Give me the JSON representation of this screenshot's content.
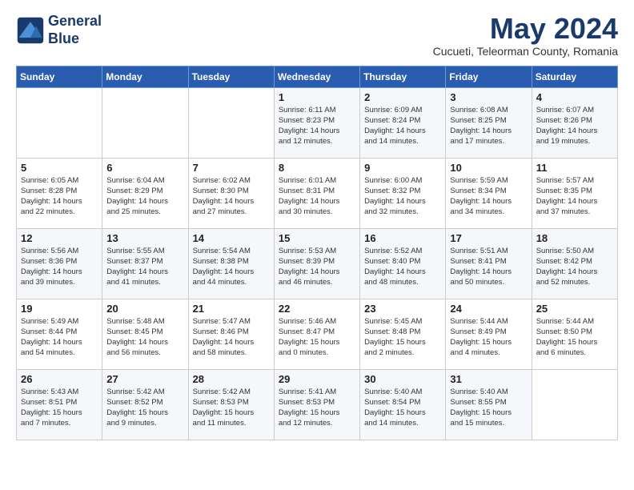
{
  "header": {
    "logo_line1": "General",
    "logo_line2": "Blue",
    "month_title": "May 2024",
    "location": "Cucueti, Teleorman County, Romania"
  },
  "weekdays": [
    "Sunday",
    "Monday",
    "Tuesday",
    "Wednesday",
    "Thursday",
    "Friday",
    "Saturday"
  ],
  "weeks": [
    [
      {
        "date": "",
        "content": ""
      },
      {
        "date": "",
        "content": ""
      },
      {
        "date": "",
        "content": ""
      },
      {
        "date": "1",
        "content": "Sunrise: 6:11 AM\nSunset: 8:23 PM\nDaylight: 14 hours\nand 12 minutes."
      },
      {
        "date": "2",
        "content": "Sunrise: 6:09 AM\nSunset: 8:24 PM\nDaylight: 14 hours\nand 14 minutes."
      },
      {
        "date": "3",
        "content": "Sunrise: 6:08 AM\nSunset: 8:25 PM\nDaylight: 14 hours\nand 17 minutes."
      },
      {
        "date": "4",
        "content": "Sunrise: 6:07 AM\nSunset: 8:26 PM\nDaylight: 14 hours\nand 19 minutes."
      }
    ],
    [
      {
        "date": "5",
        "content": "Sunrise: 6:05 AM\nSunset: 8:28 PM\nDaylight: 14 hours\nand 22 minutes."
      },
      {
        "date": "6",
        "content": "Sunrise: 6:04 AM\nSunset: 8:29 PM\nDaylight: 14 hours\nand 25 minutes."
      },
      {
        "date": "7",
        "content": "Sunrise: 6:02 AM\nSunset: 8:30 PM\nDaylight: 14 hours\nand 27 minutes."
      },
      {
        "date": "8",
        "content": "Sunrise: 6:01 AM\nSunset: 8:31 PM\nDaylight: 14 hours\nand 30 minutes."
      },
      {
        "date": "9",
        "content": "Sunrise: 6:00 AM\nSunset: 8:32 PM\nDaylight: 14 hours\nand 32 minutes."
      },
      {
        "date": "10",
        "content": "Sunrise: 5:59 AM\nSunset: 8:34 PM\nDaylight: 14 hours\nand 34 minutes."
      },
      {
        "date": "11",
        "content": "Sunrise: 5:57 AM\nSunset: 8:35 PM\nDaylight: 14 hours\nand 37 minutes."
      }
    ],
    [
      {
        "date": "12",
        "content": "Sunrise: 5:56 AM\nSunset: 8:36 PM\nDaylight: 14 hours\nand 39 minutes."
      },
      {
        "date": "13",
        "content": "Sunrise: 5:55 AM\nSunset: 8:37 PM\nDaylight: 14 hours\nand 41 minutes."
      },
      {
        "date": "14",
        "content": "Sunrise: 5:54 AM\nSunset: 8:38 PM\nDaylight: 14 hours\nand 44 minutes."
      },
      {
        "date": "15",
        "content": "Sunrise: 5:53 AM\nSunset: 8:39 PM\nDaylight: 14 hours\nand 46 minutes."
      },
      {
        "date": "16",
        "content": "Sunrise: 5:52 AM\nSunset: 8:40 PM\nDaylight: 14 hours\nand 48 minutes."
      },
      {
        "date": "17",
        "content": "Sunrise: 5:51 AM\nSunset: 8:41 PM\nDaylight: 14 hours\nand 50 minutes."
      },
      {
        "date": "18",
        "content": "Sunrise: 5:50 AM\nSunset: 8:42 PM\nDaylight: 14 hours\nand 52 minutes."
      }
    ],
    [
      {
        "date": "19",
        "content": "Sunrise: 5:49 AM\nSunset: 8:44 PM\nDaylight: 14 hours\nand 54 minutes."
      },
      {
        "date": "20",
        "content": "Sunrise: 5:48 AM\nSunset: 8:45 PM\nDaylight: 14 hours\nand 56 minutes."
      },
      {
        "date": "21",
        "content": "Sunrise: 5:47 AM\nSunset: 8:46 PM\nDaylight: 14 hours\nand 58 minutes."
      },
      {
        "date": "22",
        "content": "Sunrise: 5:46 AM\nSunset: 8:47 PM\nDaylight: 15 hours\nand 0 minutes."
      },
      {
        "date": "23",
        "content": "Sunrise: 5:45 AM\nSunset: 8:48 PM\nDaylight: 15 hours\nand 2 minutes."
      },
      {
        "date": "24",
        "content": "Sunrise: 5:44 AM\nSunset: 8:49 PM\nDaylight: 15 hours\nand 4 minutes."
      },
      {
        "date": "25",
        "content": "Sunrise: 5:44 AM\nSunset: 8:50 PM\nDaylight: 15 hours\nand 6 minutes."
      }
    ],
    [
      {
        "date": "26",
        "content": "Sunrise: 5:43 AM\nSunset: 8:51 PM\nDaylight: 15 hours\nand 7 minutes."
      },
      {
        "date": "27",
        "content": "Sunrise: 5:42 AM\nSunset: 8:52 PM\nDaylight: 15 hours\nand 9 minutes."
      },
      {
        "date": "28",
        "content": "Sunrise: 5:42 AM\nSunset: 8:53 PM\nDaylight: 15 hours\nand 11 minutes."
      },
      {
        "date": "29",
        "content": "Sunrise: 5:41 AM\nSunset: 8:53 PM\nDaylight: 15 hours\nand 12 minutes."
      },
      {
        "date": "30",
        "content": "Sunrise: 5:40 AM\nSunset: 8:54 PM\nDaylight: 15 hours\nand 14 minutes."
      },
      {
        "date": "31",
        "content": "Sunrise: 5:40 AM\nSunset: 8:55 PM\nDaylight: 15 hours\nand 15 minutes."
      },
      {
        "date": "",
        "content": ""
      }
    ]
  ]
}
